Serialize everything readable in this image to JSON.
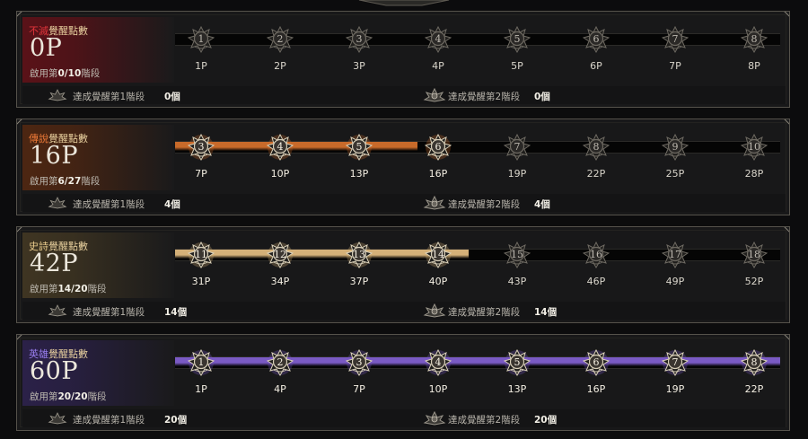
{
  "tiers": [
    {
      "id": "immortal",
      "label_prefix": "不滅",
      "label_suffix": "覺醒點數",
      "prefix_color": "#e0343a",
      "bg_color": "#5a1218",
      "fill_color": "",
      "points": "0P",
      "stage_prefix": "啟用第",
      "stage_value": "0/10",
      "stage_suffix": "階段",
      "filled_fraction": 0,
      "nodes": [
        {
          "n": "1",
          "cost": "1P",
          "on": false
        },
        {
          "n": "2",
          "cost": "2P",
          "on": false
        },
        {
          "n": "3",
          "cost": "3P",
          "on": false
        },
        {
          "n": "4",
          "cost": "4P",
          "on": false
        },
        {
          "n": "5",
          "cost": "5P",
          "on": false
        },
        {
          "n": "6",
          "cost": "6P",
          "on": false
        },
        {
          "n": "7",
          "cost": "7P",
          "on": false
        },
        {
          "n": "8",
          "cost": "8P",
          "on": false
        }
      ],
      "ach1": {
        "text": "達成覺醒第1階段",
        "count": "0個"
      },
      "ach2": {
        "text": "達成覺醒第2階段",
        "count": "0個"
      }
    },
    {
      "id": "legendary",
      "label_prefix": "傳說",
      "label_suffix": "覺醒點數",
      "prefix_color": "#ef7a37",
      "bg_color": "#4d2612",
      "fill_color": "#c86a2a",
      "points": "16P",
      "stage_prefix": "啟用第",
      "stage_value": "6/27",
      "stage_suffix": "階段",
      "filled_fraction": 0.4,
      "nodes": [
        {
          "n": "3",
          "cost": "7P",
          "on": true
        },
        {
          "n": "4",
          "cost": "10P",
          "on": true
        },
        {
          "n": "5",
          "cost": "13P",
          "on": true
        },
        {
          "n": "6",
          "cost": "16P",
          "on": true
        },
        {
          "n": "7",
          "cost": "19P",
          "on": false
        },
        {
          "n": "8",
          "cost": "22P",
          "on": false
        },
        {
          "n": "9",
          "cost": "25P",
          "on": false
        },
        {
          "n": "10",
          "cost": "28P",
          "on": false
        }
      ],
      "ach1": {
        "text": "達成覺醒第1階段",
        "count": "4個"
      },
      "ach2": {
        "text": "達成覺醒第2階段",
        "count": "4個"
      }
    },
    {
      "id": "epic",
      "label_prefix": "史詩",
      "label_suffix": "覺醒點數",
      "prefix_color": "#e9cb8c",
      "bg_color": "#3f3522",
      "fill_color": "#d4b078",
      "points": "42P",
      "stage_prefix": "啟用第",
      "stage_value": "14/20",
      "stage_suffix": "階段",
      "filled_fraction": 0.485,
      "nodes": [
        {
          "n": "11",
          "cost": "31P",
          "on": true
        },
        {
          "n": "12",
          "cost": "34P",
          "on": true
        },
        {
          "n": "13",
          "cost": "37P",
          "on": true
        },
        {
          "n": "14",
          "cost": "40P",
          "on": true
        },
        {
          "n": "15",
          "cost": "43P",
          "on": false
        },
        {
          "n": "16",
          "cost": "46P",
          "on": false
        },
        {
          "n": "17",
          "cost": "49P",
          "on": false
        },
        {
          "n": "18",
          "cost": "52P",
          "on": false
        }
      ],
      "ach1": {
        "text": "達成覺醒第1階段",
        "count": "14個"
      },
      "ach2": {
        "text": "達成覺醒第2階段",
        "count": "14個"
      }
    },
    {
      "id": "heroic",
      "label_prefix": "英雄",
      "label_suffix": "覺醒點數",
      "prefix_color": "#9a7ef0",
      "bg_color": "#2b2148",
      "fill_color": "#7a5ac4",
      "points": "60P",
      "stage_prefix": "啟用第",
      "stage_value": "20/20",
      "stage_suffix": "階段",
      "filled_fraction": 1,
      "nodes": [
        {
          "n": "1",
          "cost": "1P",
          "on": true
        },
        {
          "n": "2",
          "cost": "4P",
          "on": true
        },
        {
          "n": "3",
          "cost": "7P",
          "on": true
        },
        {
          "n": "4",
          "cost": "10P",
          "on": true
        },
        {
          "n": "5",
          "cost": "13P",
          "on": true
        },
        {
          "n": "6",
          "cost": "16P",
          "on": true
        },
        {
          "n": "7",
          "cost": "19P",
          "on": true
        },
        {
          "n": "8",
          "cost": "22P",
          "on": true
        }
      ],
      "ach1": {
        "text": "達成覺醒第1階段",
        "count": "20個"
      },
      "ach2": {
        "text": "達成覺醒第2階段",
        "count": "20個"
      }
    }
  ]
}
